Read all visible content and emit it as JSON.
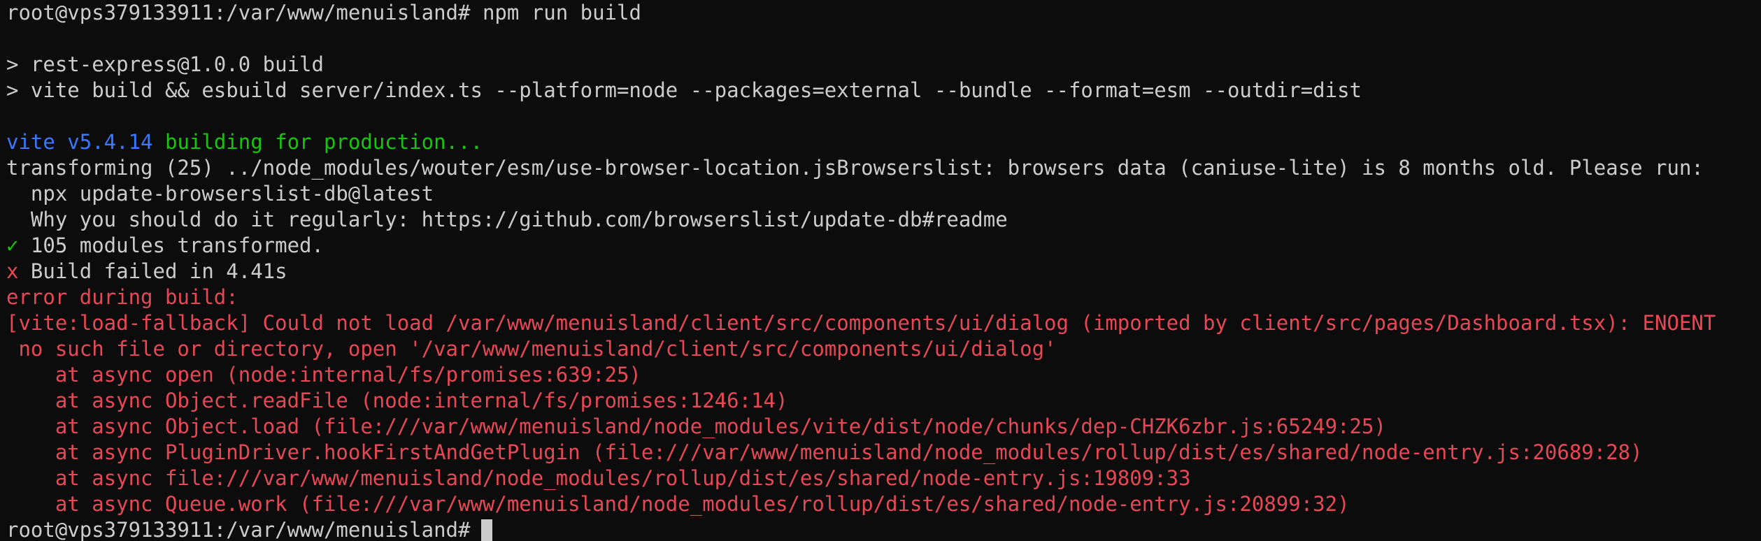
{
  "terminal": {
    "prompt": "root@vps379133911:/var/www/menuisland#",
    "command": "npm run build",
    "script_line_1": "> rest-express@1.0.0 build",
    "script_line_2": "> vite build && esbuild server/index.ts --platform=node --packages=external --bundle --format=esm --outdir=dist",
    "vite_version": "vite v5.4.14",
    "building": "building for production...",
    "transforming": "transforming (25) ../node_modules/wouter/esm/use-browser-location.jsBrowserslist: browsers data (caniuse-lite) is 8 months old. Please run:",
    "npx_line": "  npx update-browserslist-db@latest",
    "why_line": "  Why you should do it regularly: https://github.com/browserslist/update-db#readme",
    "check_mark": "✓",
    "modules_transformed": " 105 modules transformed.",
    "x_mark": "x",
    "build_failed": " Build failed in 4.41s",
    "error_during_build": "error during build:",
    "error_main": "[vite:load-fallback] Could not load /var/www/menuisland/client/src/components/ui/dialog (imported by client/src/pages/Dashboard.tsx): ENOENT",
    "error_detail": " no such file or directory, open '/var/www/menuisland/client/src/components/ui/dialog'",
    "stack": [
      "    at async open (node:internal/fs/promises:639:25)",
      "    at async Object.readFile (node:internal/fs/promises:1246:14)",
      "    at async Object.load (file:///var/www/menuisland/node_modules/vite/dist/node/chunks/dep-CHZK6zbr.js:65249:25)",
      "    at async PluginDriver.hookFirstAndGetPlugin (file:///var/www/menuisland/node_modules/rollup/dist/es/shared/node-entry.js:20689:28)",
      "    at async file:///var/www/menuisland/node_modules/rollup/dist/es/shared/node-entry.js:19809:33",
      "    at async Queue.work (file:///var/www/menuisland/node_modules/rollup/dist/es/shared/node-entry.js:20899:32)"
    ],
    "colors": {
      "background": "#0c0c0c",
      "foreground": "#cccccc",
      "error_red": "#e74856",
      "vite_blue": "#3b78ff",
      "success_green": "#16c60c"
    }
  }
}
